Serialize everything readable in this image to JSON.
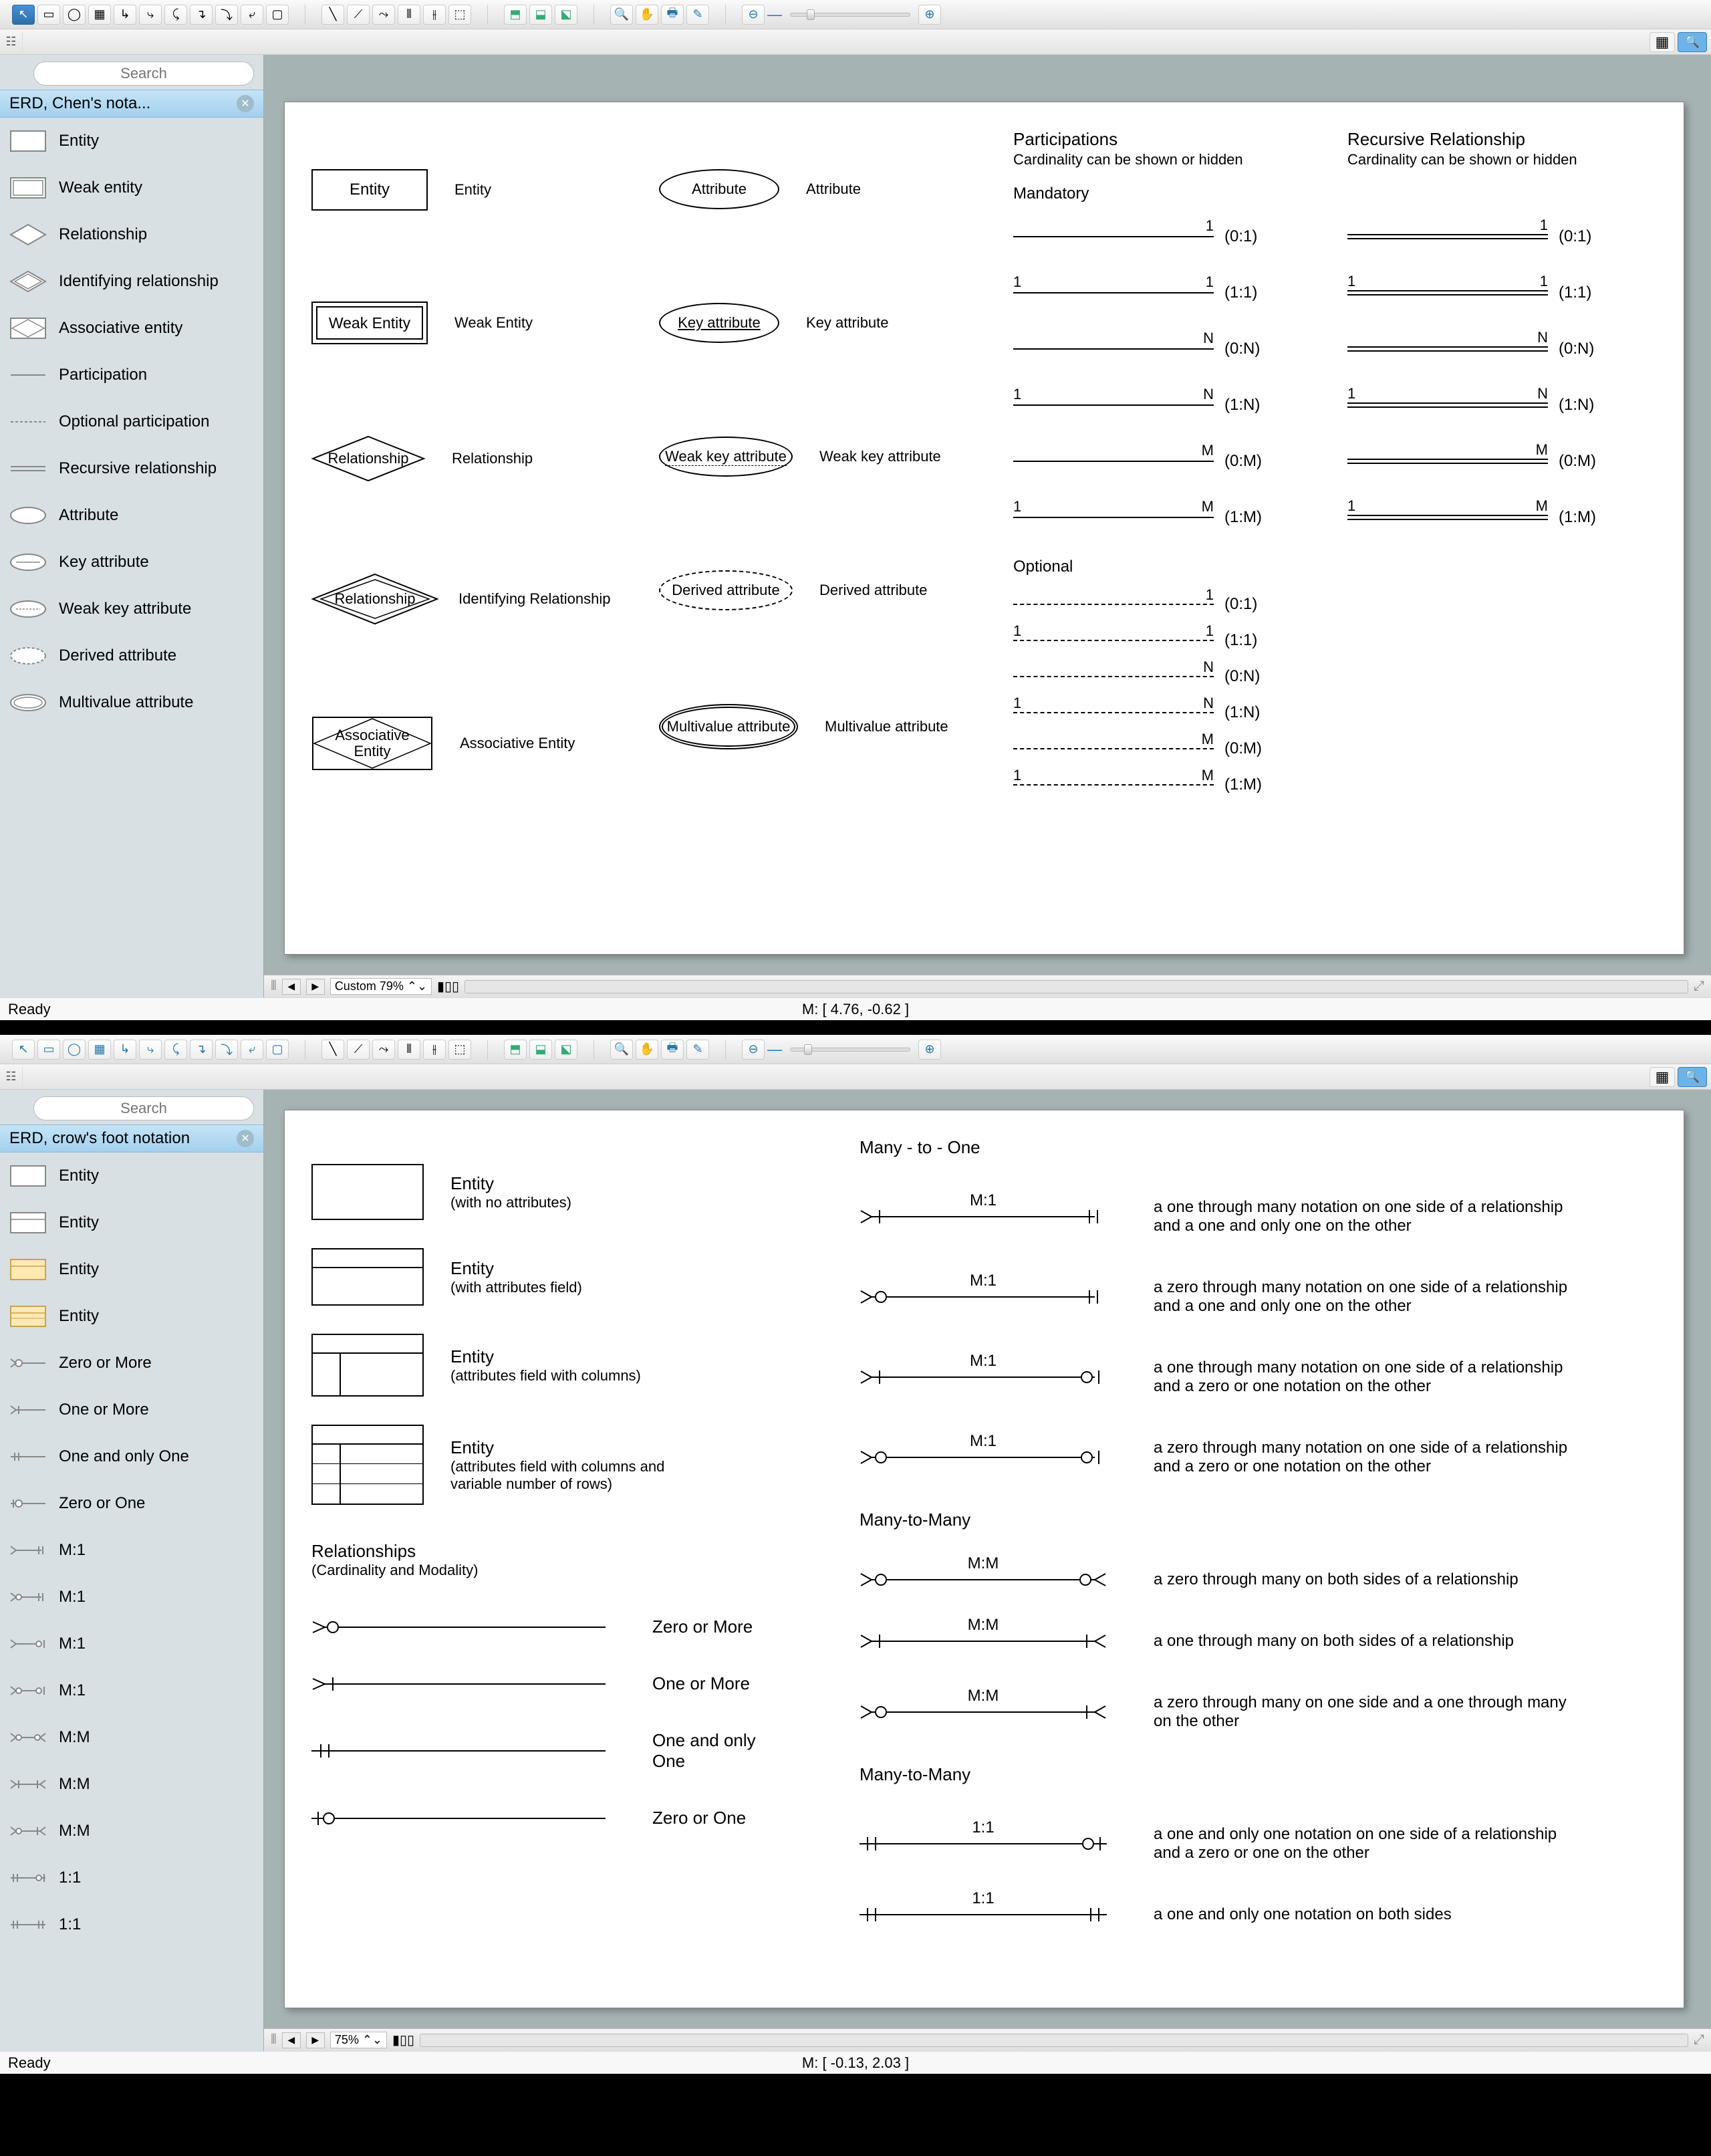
{
  "app1": {
    "search_placeholder": "Search",
    "panel_title": "ERD, Chen's nota...",
    "stencils": [
      "Entity",
      "Weak entity",
      "Relationship",
      "Identifying relationship",
      "Associative entity",
      "Participation",
      "Optional participation",
      "Recursive relationship",
      "Attribute",
      "Key attribute",
      "Weak key attribute",
      "Derived attribute",
      "Multivalue attribute"
    ],
    "canvas": {
      "col1": {
        "entity": "Entity",
        "weak_entity": "Weak Entity",
        "relationship": "Relationship",
        "identifying": "Relationship",
        "associative": "Associative\nEntity"
      },
      "col1_labels": [
        "Entity",
        "Weak Entity",
        "Relationship",
        "Identifying Relationship",
        "Associative Entity"
      ],
      "col2": {
        "attribute": "Attribute",
        "key": "Key attribute",
        "weakkey": "Weak key attribute",
        "derived": "Derived attribute",
        "multi": "Multivalue attribute"
      },
      "col2_labels": [
        "Attribute",
        "Key attribute",
        "Weak key attribute",
        "Derived attribute",
        "Multivalue attribute"
      ],
      "participations_title": "Participations",
      "participations_sub": "Cardinality can be shown or hidden",
      "recursive_title": "Recursive Relationship",
      "recursive_sub": "Cardinality can be shown or hidden",
      "mandatory": "Mandatory",
      "optional": "Optional",
      "participation_rows": [
        {
          "l": "",
          "r": "1",
          "card": "(0:1)"
        },
        {
          "l": "1",
          "r": "1",
          "card": "(1:1)"
        },
        {
          "l": "",
          "r": "N",
          "card": "(0:N)"
        },
        {
          "l": "1",
          "r": "N",
          "card": "(1:N)"
        },
        {
          "l": "",
          "r": "M",
          "card": "(0:M)"
        },
        {
          "l": "1",
          "r": "M",
          "card": "(1:M)"
        }
      ],
      "optional_rows": [
        {
          "l": "",
          "r": "1",
          "card": "(0:1)"
        },
        {
          "l": "1",
          "r": "1",
          "card": "(1:1)"
        },
        {
          "l": "",
          "r": "N",
          "card": "(0:N)"
        },
        {
          "l": "1",
          "r": "N",
          "card": "(1:N)"
        },
        {
          "l": "",
          "r": "M",
          "card": "(0:M)"
        },
        {
          "l": "1",
          "r": "M",
          "card": "(1:M)"
        }
      ]
    },
    "zoom": "Custom 79%",
    "status_ready": "Ready",
    "status_coords": "M: [  4.76, -0.62  ]"
  },
  "app2": {
    "search_placeholder": "Search",
    "panel_title": "ERD, crow's foot notation",
    "stencils": [
      "Entity",
      "Entity",
      "Entity",
      "Entity",
      "Zero or More",
      "One or More",
      "One and only One",
      "Zero or One",
      "M:1",
      "M:1",
      "M:1",
      "M:1",
      "M:M",
      "M:M",
      "M:M",
      "1:1",
      "1:1"
    ],
    "canvas": {
      "entities": [
        {
          "title": "Entity",
          "sub": "(with no attributes)"
        },
        {
          "title": "Entity",
          "sub": "(with attributes field)"
        },
        {
          "title": "Entity",
          "sub": "(attributes field with columns)"
        },
        {
          "title": "Entity",
          "sub": "(attributes field with columns and variable number of rows)"
        }
      ],
      "rel_header": "Relationships",
      "rel_sub": "(Cardinality and Modality)",
      "simple_rels": [
        "Zero or More",
        "One or More",
        "One and only One",
        "Zero or One"
      ],
      "m1_title": "Many - to - One",
      "m1_rows": [
        {
          "label": "M:1",
          "desc": "a one through many notation on one side of a relationship and a one and only one on the other"
        },
        {
          "label": "M:1",
          "desc": "a zero through many notation on one side of a relationship and a one and only one on the other"
        },
        {
          "label": "M:1",
          "desc": "a one through many notation on one side of a relationship and a zero or one notation on the other"
        },
        {
          "label": "M:1",
          "desc": "a zero through many notation on one side of a relationship and a zero or one notation on the other"
        }
      ],
      "mm_title": "Many-to-Many",
      "mm_rows": [
        {
          "label": "M:M",
          "desc": "a zero through many on both sides of a relationship"
        },
        {
          "label": "M:M",
          "desc": "a one through many on both sides of a relationship"
        },
        {
          "label": "M:M",
          "desc": "a zero through many on one side and a one through many on the other"
        }
      ],
      "oo_title": "Many-to-Many",
      "oo_rows": [
        {
          "label": "1:1",
          "desc": "a one and only one notation on one side of a relationship and a zero or one on the other"
        },
        {
          "label": "1:1",
          "desc": "a one and only one notation on both sides"
        }
      ]
    },
    "zoom": "75%",
    "status_ready": "Ready",
    "status_coords": "M: [  -0.13, 2.03  ]"
  }
}
